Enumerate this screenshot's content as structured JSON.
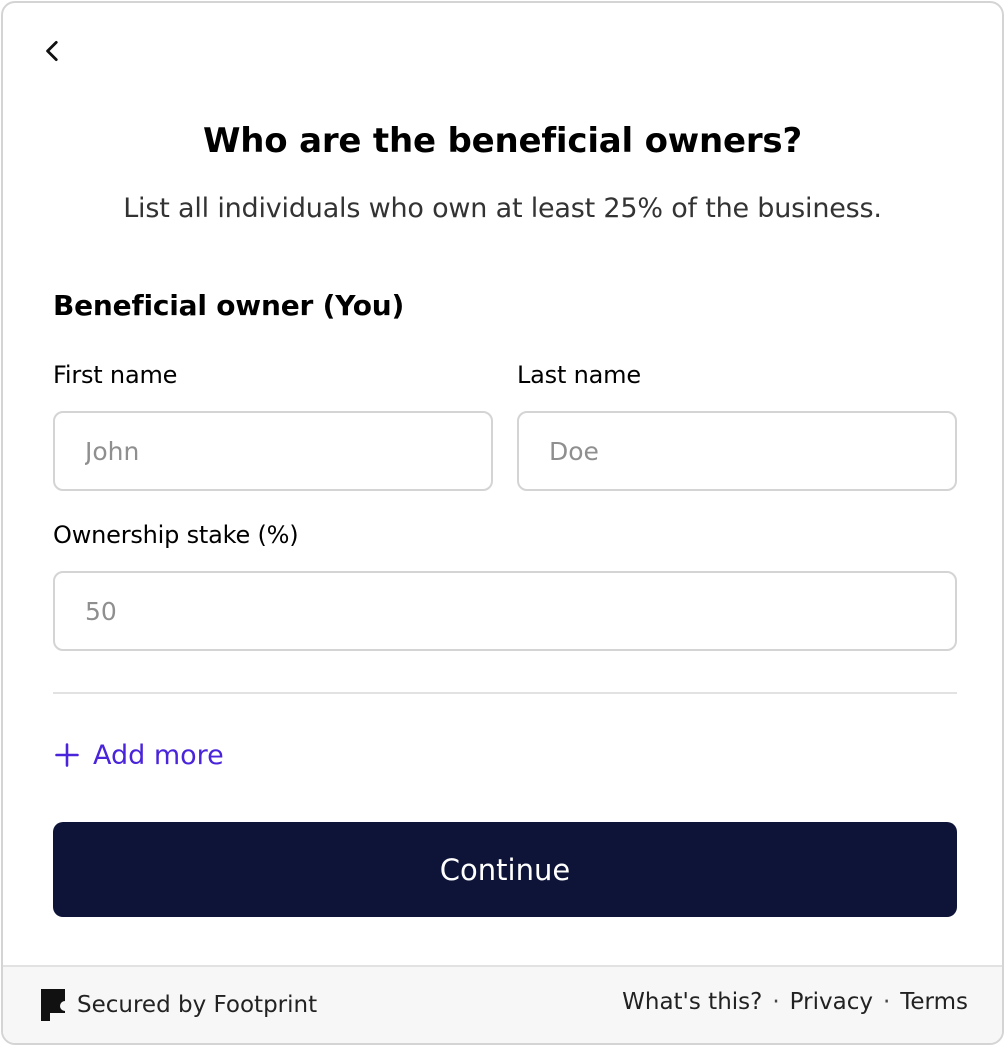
{
  "header": {
    "title": "Who are the beneficial owners?",
    "subtitle": "List all individuals who own at least 25% of the business.",
    "back_icon": "chevron-left-icon"
  },
  "form": {
    "section_title": "Beneficial owner (You)",
    "first_name": {
      "label": "First name",
      "value": "",
      "placeholder": "John"
    },
    "last_name": {
      "label": "Last name",
      "value": "",
      "placeholder": "Doe"
    },
    "ownership": {
      "label": "Ownership stake (%)",
      "value": "",
      "placeholder": "50"
    },
    "add_more_label": "Add more",
    "add_more_icon": "plus-icon",
    "continue_label": "Continue"
  },
  "footer": {
    "brand_text": "Secured by Footprint",
    "brand_icon": "footprint-logo-icon",
    "links": {
      "whats_this": "What's this?",
      "privacy": "Privacy",
      "terms": "Terms"
    },
    "separator": "·"
  },
  "colors": {
    "accent": "#4a24db",
    "primary_button": "#0e1438",
    "border": "#d4d4d4",
    "footer_bg": "#f7f7f7"
  }
}
